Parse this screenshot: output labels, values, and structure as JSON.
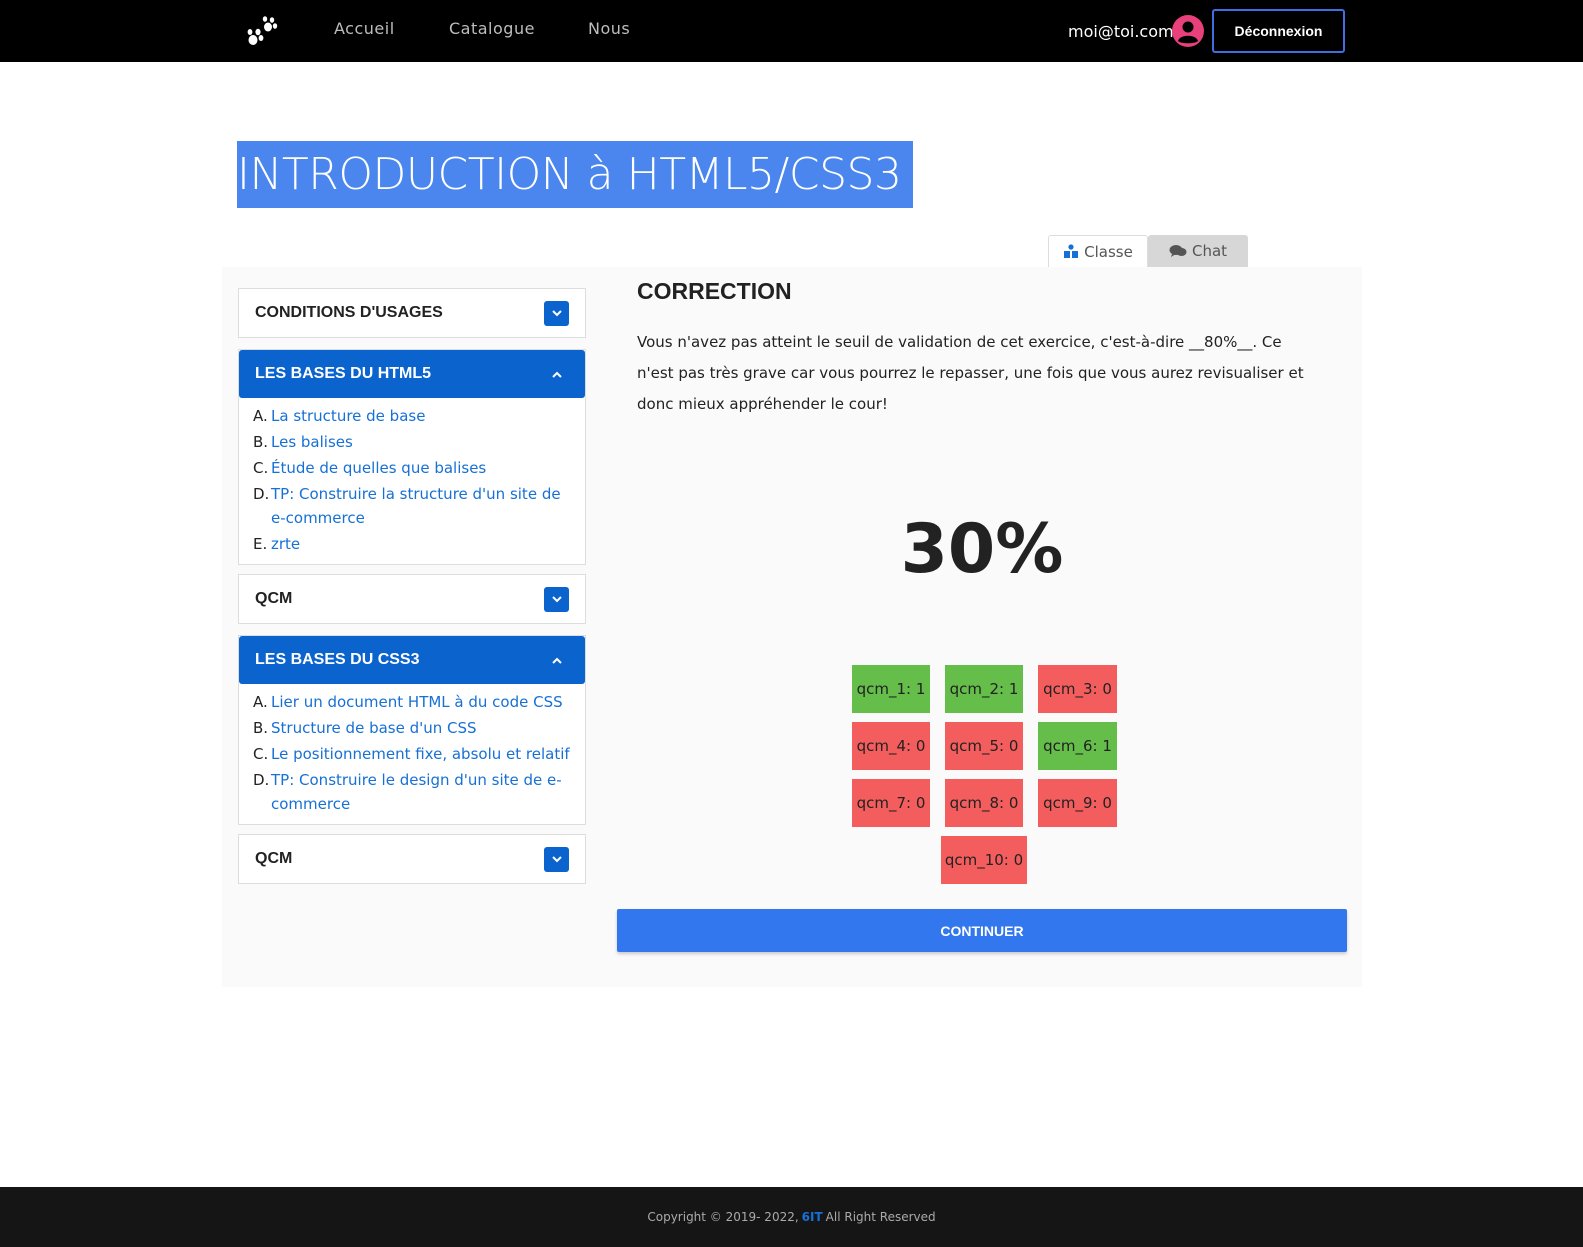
{
  "nav": {
    "links": [
      "Accueil",
      "Catalogue",
      "Nous"
    ],
    "user_email": "moi@toi.com",
    "logout_label": "Déconnexion"
  },
  "page": {
    "title": "INTRODUCTION à HTML5/CSS3"
  },
  "tabs": [
    {
      "label": "Classe",
      "icon": "classroom-icon",
      "active": true
    },
    {
      "label": "Chat",
      "icon": "chat-icon",
      "active": false
    }
  ],
  "sidebar": {
    "sections": [
      {
        "title": "CONDITIONS D'USAGES",
        "expanded": false,
        "items": []
      },
      {
        "title": "LES BASES DU HTML5",
        "expanded": true,
        "items": [
          {
            "letter": "A.",
            "label": "La structure de base"
          },
          {
            "letter": "B.",
            "label": "Les balises"
          },
          {
            "letter": "C.",
            "label": "Étude de quelles que balises"
          },
          {
            "letter": "D.",
            "label": "TP: Construire la structure d'un site de e-commerce"
          },
          {
            "letter": "E.",
            "label": "zrte"
          }
        ]
      },
      {
        "title": "QCM",
        "expanded": false,
        "items": []
      },
      {
        "title": "LES BASES DU CSS3",
        "expanded": true,
        "items": [
          {
            "letter": "A.",
            "label": "Lier un document HTML à du code CSS"
          },
          {
            "letter": "B.",
            "label": "Structure de base d'un CSS"
          },
          {
            "letter": "C.",
            "label": "Le positionnement fixe, absolu et relatif"
          },
          {
            "letter": "D.",
            "label": "TP: Construire le design d'un site de e-commerce"
          }
        ]
      },
      {
        "title": "QCM",
        "expanded": false,
        "items": []
      }
    ]
  },
  "correction": {
    "title": "CORRECTION",
    "text": "Vous n'avez pas atteint le seuil de validation de cet exercice, c'est-à-dire __80%__. Ce n'est pas très grave car vous pourrez le repasser, une fois que vous aurez revisualiser et donc mieux appréhender le cour!",
    "score": "30%",
    "results": [
      {
        "label": "qcm_1: 1",
        "correct": true
      },
      {
        "label": "qcm_2: 1",
        "correct": true
      },
      {
        "label": "qcm_3: 0",
        "correct": false
      },
      {
        "label": "qcm_4: 0",
        "correct": false
      },
      {
        "label": "qcm_5: 0",
        "correct": false
      },
      {
        "label": "qcm_6: 1",
        "correct": true
      },
      {
        "label": "qcm_7: 0",
        "correct": false
      },
      {
        "label": "qcm_8: 0",
        "correct": false
      },
      {
        "label": "qcm_9: 0",
        "correct": false
      },
      {
        "label": "qcm_10: 0",
        "correct": false
      }
    ],
    "continue_label": "CONTINUER"
  },
  "footer": {
    "prefix": "Copyright © 2019- 2022,",
    "brand": "6IT",
    "suffix": "All Right Reserved"
  },
  "colors": {
    "accent": "#0b63ce",
    "title_bg": "#4a86ee",
    "button": "#3277ed",
    "ok": "#65bd4a",
    "ko": "#f45d5d",
    "avatar": "#e8407a"
  }
}
